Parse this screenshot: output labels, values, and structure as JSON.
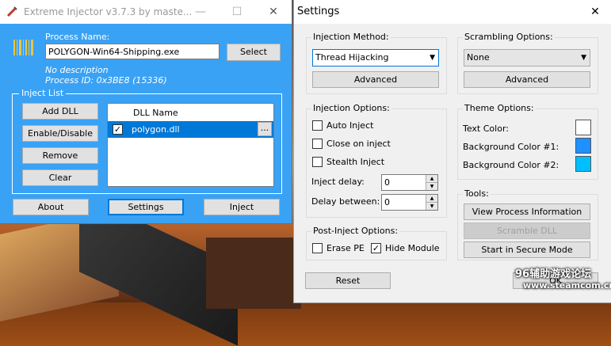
{
  "injector": {
    "title": "Extreme Injector v3.7.3 by maste...",
    "process_name_label": "Process Name:",
    "process_name_value": "POLYGON-Win64-Shipping.exe",
    "select_button": "Select",
    "description": "No description",
    "process_id": "Process ID: 0x3BE8 (15336)",
    "inject_list_label": "Inject List",
    "add_dll": "Add DLL",
    "enable_disable": "Enable/Disable",
    "remove": "Remove",
    "clear": "Clear",
    "dll_column": "DLL Name",
    "dll_items": [
      {
        "name": "polygon.dll",
        "checked": true
      }
    ],
    "dots": "...",
    "about": "About",
    "settings": "Settings",
    "inject": "Inject"
  },
  "settings": {
    "title": "Settings",
    "close_glyph": "✕",
    "injection_method_label": "Injection Method:",
    "injection_method_value": "Thread Hijacking",
    "advanced1": "Advanced",
    "scrambling_label": "Scrambling Options:",
    "scrambling_value": "None",
    "advanced2": "Advanced",
    "injection_options_label": "Injection Options:",
    "auto_inject": "Auto Inject",
    "close_on_inject": "Close on inject",
    "stealth_inject": "Stealth Inject",
    "inject_delay_label": "Inject delay:",
    "inject_delay_value": "0",
    "delay_between_label": "Delay between:",
    "delay_between_value": "0",
    "theme_label": "Theme Options:",
    "text_color_label": "Text Color:",
    "bg1_label": "Background Color #1:",
    "bg2_label": "Background Color #2:",
    "tools_label": "Tools:",
    "view_process_info": "View Process Information",
    "scramble_dll": "Scramble DLL",
    "secure_mode": "Start in Secure Mode",
    "post_inject_label": "Post-Inject Options:",
    "erase_pe": "Erase PE",
    "hide_module": "Hide Module",
    "reset": "Reset",
    "ok": "OK"
  },
  "colors": {
    "text_color": "#ffffff",
    "bg1": "#1e90ff",
    "bg2": "#00bfff",
    "injector_bg": "#3aa2f5"
  },
  "watermark": {
    "line1": "96辅助游戏论坛",
    "line2": "www.steamcom.cn"
  }
}
